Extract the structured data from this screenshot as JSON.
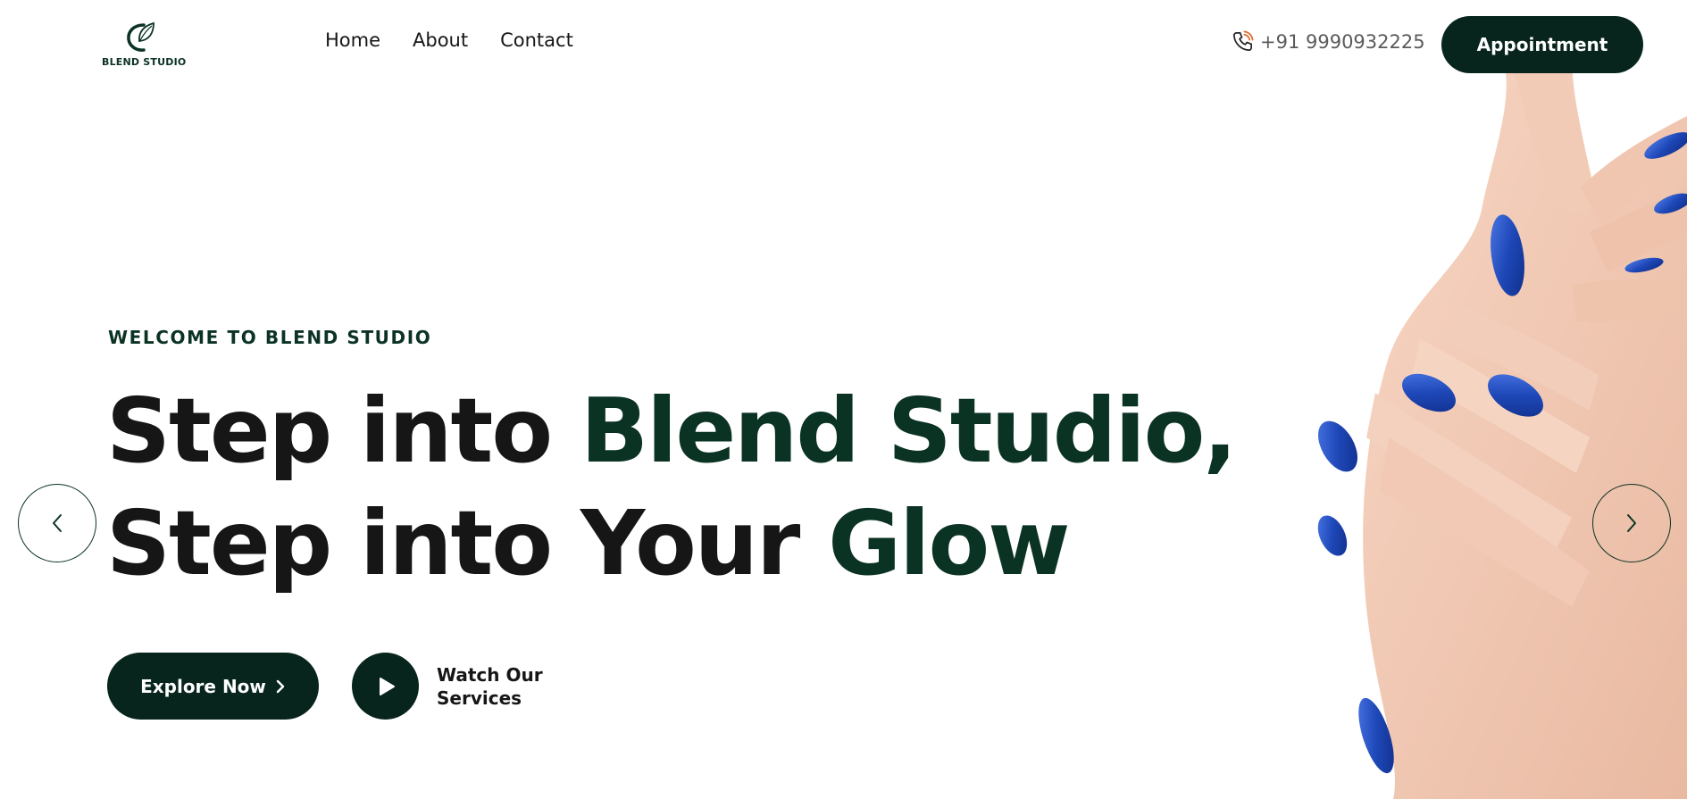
{
  "brand": {
    "name": "BLEND STUDIO",
    "logo_icon": "leaf-swirl-icon",
    "color": "#0b3324"
  },
  "nav": {
    "items": [
      {
        "label": "Home"
      },
      {
        "label": "About"
      },
      {
        "label": "Contact"
      }
    ]
  },
  "header": {
    "phone_icon": "phone-icon",
    "phone": "+91 9990932225",
    "appointment_label": "Appointment"
  },
  "hero": {
    "eyebrow": "WELCOME TO BLEND STUDIO",
    "line1_plain": "Step into ",
    "line1_accent": "Blend Studio,",
    "line2_plain": "Step into Your ",
    "line2_accent": "Glow",
    "explore_label": "Explore Now",
    "explore_icon": "chevron-right-icon",
    "watch_icon": "play-icon",
    "watch_label": "Watch Our Services",
    "image_alt": "hands with blue nail polish"
  },
  "carousel": {
    "prev_icon": "chevron-left-icon",
    "next_icon": "chevron-right-icon"
  },
  "colors": {
    "accent": "#0b3324",
    "button": "#07251c",
    "nail": "#1e48b8",
    "skin": "#f3cdb8"
  }
}
